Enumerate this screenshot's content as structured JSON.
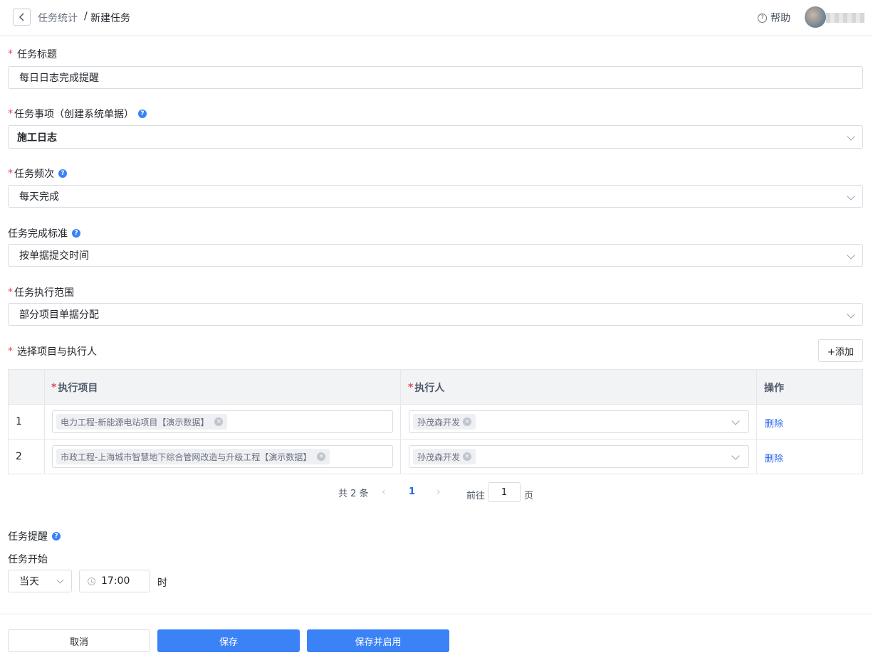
{
  "header": {
    "breadcrumb_parent": "任务统计",
    "breadcrumb_separator": "/",
    "breadcrumb_current": "新建任务",
    "help_label": "帮助"
  },
  "form": {
    "title": {
      "required": true,
      "label": "任务标题",
      "value": "每日日志完成提醒"
    },
    "item": {
      "required": true,
      "label": "任务事项（创建系统单据）",
      "value": "施工日志"
    },
    "frequency": {
      "required": true,
      "label": "任务频次",
      "value": "每天完成"
    },
    "standard": {
      "required": false,
      "label": "任务完成标准",
      "value": "按单据提交时间"
    },
    "scope": {
      "required": true,
      "label": "任务执行范围",
      "value": "部分项目单据分配"
    },
    "assignments": {
      "required": true,
      "label": "选择项目与执行人",
      "add_label": "+添加",
      "columns": [
        "",
        "执行项目",
        "执行人",
        "操作"
      ],
      "rows": [
        {
          "index": "1",
          "project": "电力工程-新能源电站项目【演示数据】",
          "executor": "孙茂森开发",
          "action": "删除"
        },
        {
          "index": "2",
          "project": "市政工程-上海城市智慧地下综合管网改造与升级工程【演示数据】",
          "executor": "孙茂森开发",
          "action": "删除"
        }
      ]
    },
    "pagination": {
      "total_text": "共 2 条",
      "prev": "‹",
      "current": "1",
      "next": "›",
      "goto_label": "前往",
      "goto_value": "1",
      "page_label": "页"
    },
    "reminder": {
      "title": "任务提醒",
      "start_label": "任务开始",
      "day_value": "当天",
      "time_value": "17:00",
      "unit": "时"
    }
  },
  "footer": {
    "cancel": "取消",
    "save": "保存",
    "save_enable": "保存并启用"
  },
  "colors": {
    "primary": "#3b82f6",
    "required": "#e34d59",
    "link": "#2563eb"
  }
}
